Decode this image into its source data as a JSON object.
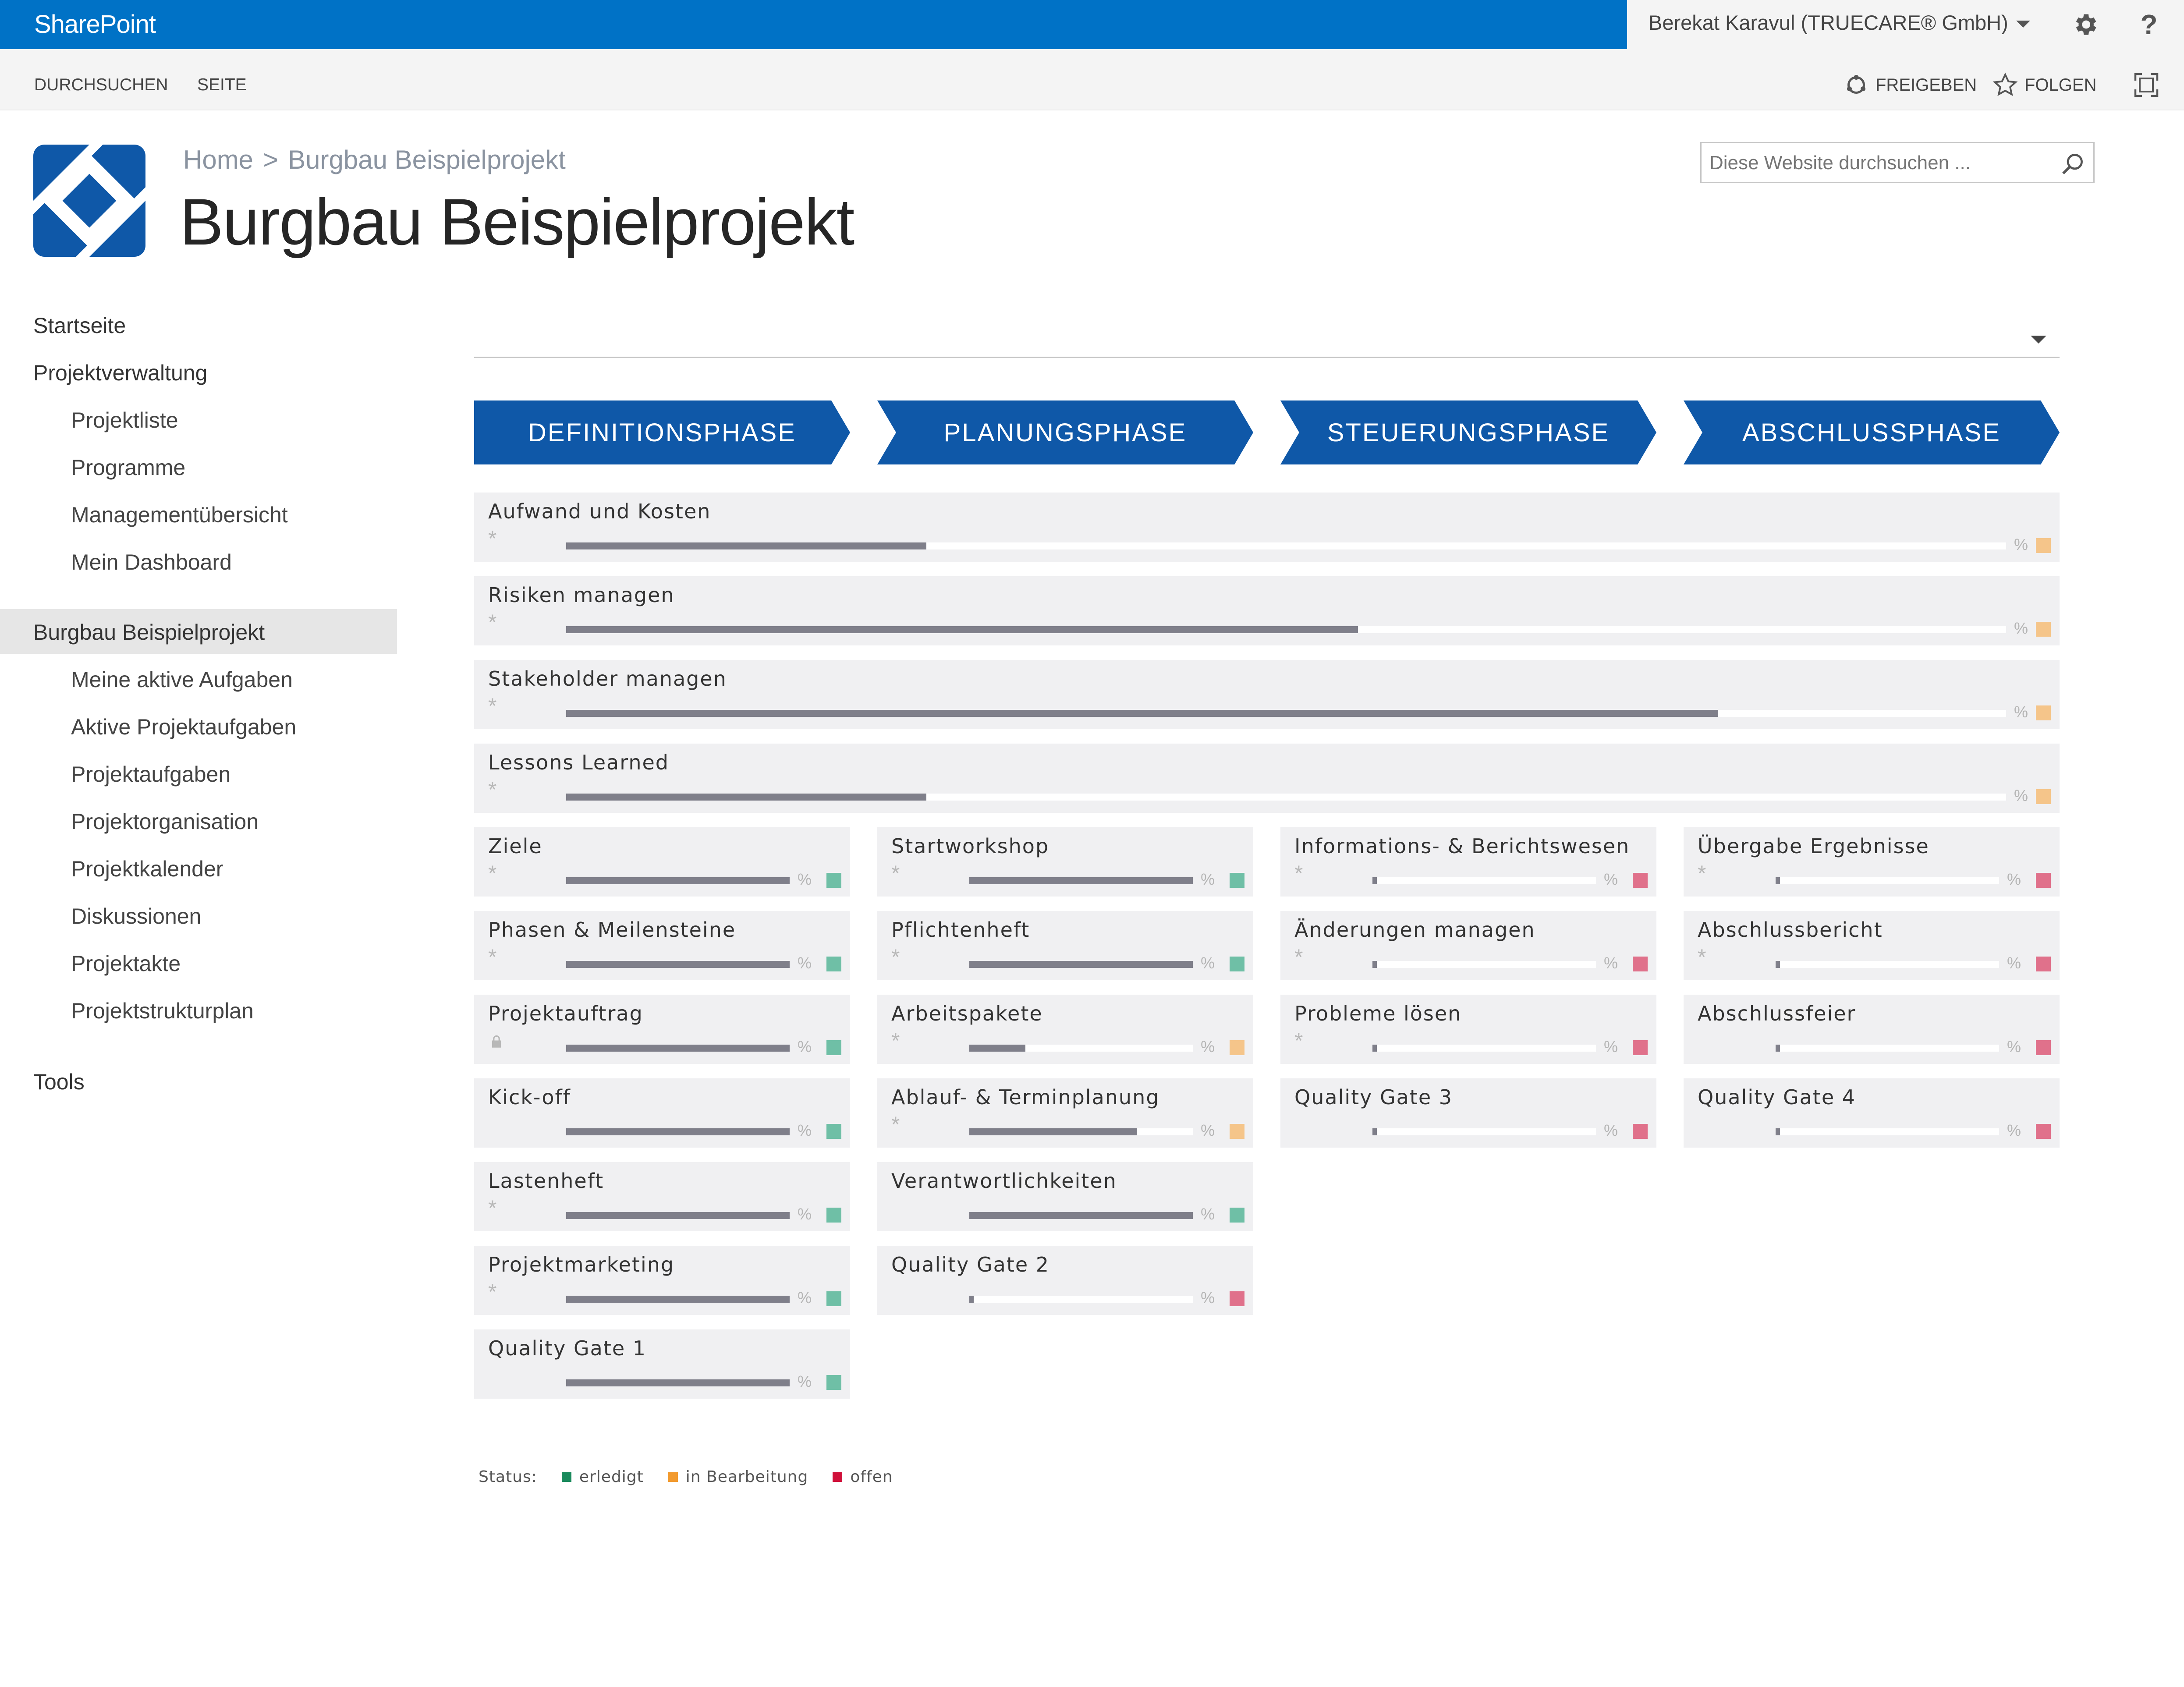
{
  "suite": {
    "brand": "SharePoint",
    "user": "Berekat Karavul (TRUECARE® GmbH)",
    "icons": [
      "gear-icon",
      "help-icon"
    ],
    "help_glyph": "?"
  },
  "ribbon": {
    "tabs": [
      "DURCHSUCHEN",
      "SEITE"
    ],
    "share_label": "FREIGEBEN",
    "follow_label": "FOLGEN",
    "focus_icon": "focus-mode-icon"
  },
  "header": {
    "breadcrumb_home": "Home",
    "breadcrumb_sep": ">",
    "breadcrumb_current": "Burgbau Beispielprojekt",
    "title": "Burgbau Beispielprojekt",
    "search_placeholder": "Diese Website durchsuchen ..."
  },
  "nav": {
    "items": [
      {
        "label": "Startseite",
        "level": 0
      },
      {
        "label": "Projektverwaltung",
        "level": 0
      },
      {
        "label": "Projektliste",
        "level": 1
      },
      {
        "label": "Programme",
        "level": 1
      },
      {
        "label": "Managementübersicht",
        "level": 1
      },
      {
        "label": "Mein Dashboard",
        "level": 1
      },
      {
        "label": "Burgbau Beispielprojekt",
        "level": 0,
        "selected": true
      },
      {
        "label": "Meine aktive Aufgaben",
        "level": 1
      },
      {
        "label": "Aktive Projektaufgaben",
        "level": 1
      },
      {
        "label": "Projektaufgaben",
        "level": 1
      },
      {
        "label": "Projektorganisation",
        "level": 1
      },
      {
        "label": "Projektkalender",
        "level": 1
      },
      {
        "label": "Diskussionen",
        "level": 1
      },
      {
        "label": "Projektakte",
        "level": 1
      },
      {
        "label": "Projektstrukturplan",
        "level": 1
      },
      {
        "label": "Tools",
        "level": 0
      }
    ]
  },
  "colors": {
    "brand": "#0072c6",
    "phase": "#0f58a8",
    "done": "#6fbfa6",
    "in_progress": "#f5c58a",
    "open": "#e0718b",
    "legend_done": "#1a8a5c",
    "legend_in_progress": "#f29a2e",
    "legend_open": "#d0103a"
  },
  "phases": [
    "DEFINITIONSPHASE",
    "PLANUNGSPHASE",
    "STEUERUNGSPHASE",
    "ABSCHLUSSPHASE"
  ],
  "wide_tasks": [
    {
      "title": "Aufwand und Kosten",
      "progress": 0.25,
      "status": "in_progress",
      "mark": "*"
    },
    {
      "title": "Risiken managen",
      "progress": 0.55,
      "status": "in_progress",
      "mark": "*"
    },
    {
      "title": "Stakeholder managen",
      "progress": 0.8,
      "status": "in_progress",
      "mark": "*"
    },
    {
      "title": "Lessons Learned",
      "progress": 0.25,
      "status": "in_progress",
      "mark": "*"
    }
  ],
  "columns": [
    [
      {
        "title": "Ziele",
        "progress": 1.0,
        "status": "done",
        "mark": "*"
      },
      {
        "title": "Phasen & Meilensteine",
        "progress": 1.0,
        "status": "done",
        "mark": "*"
      },
      {
        "title": "Projektauftrag",
        "progress": 1.0,
        "status": "done",
        "mark": "lock"
      },
      {
        "title": "Kick-off",
        "progress": 1.0,
        "status": "done",
        "mark": ""
      },
      {
        "title": "Lastenheft",
        "progress": 1.0,
        "status": "done",
        "mark": "*"
      },
      {
        "title": "Projektmarketing",
        "progress": 1.0,
        "status": "done",
        "mark": "*"
      },
      {
        "title": "Quality Gate 1",
        "progress": 1.0,
        "status": "done",
        "mark": ""
      }
    ],
    [
      {
        "title": "Startworkshop",
        "progress": 1.0,
        "status": "done",
        "mark": "*"
      },
      {
        "title": "Pflichtenheft",
        "progress": 1.0,
        "status": "done",
        "mark": "*"
      },
      {
        "title": "Arbeitspakete",
        "progress": 0.25,
        "status": "in_progress",
        "mark": "*"
      },
      {
        "title": "Ablauf- & Terminplanung",
        "progress": 0.75,
        "status": "in_progress",
        "mark": "*"
      },
      {
        "title": "Verantwortlichkeiten",
        "progress": 1.0,
        "status": "done",
        "mark": ""
      },
      {
        "title": "Quality Gate 2",
        "progress": 0.02,
        "status": "open",
        "mark": ""
      }
    ],
    [
      {
        "title": "Informations- & Berichtswesen",
        "progress": 0.02,
        "status": "open",
        "mark": "*"
      },
      {
        "title": "Änderungen managen",
        "progress": 0.02,
        "status": "open",
        "mark": "*"
      },
      {
        "title": "Probleme lösen",
        "progress": 0.02,
        "status": "open",
        "mark": "*"
      },
      {
        "title": "Quality Gate 3",
        "progress": 0.02,
        "status": "open",
        "mark": ""
      }
    ],
    [
      {
        "title": "Übergabe Ergebnisse",
        "progress": 0.02,
        "status": "open",
        "mark": "*"
      },
      {
        "title": "Abschlussbericht",
        "progress": 0.02,
        "status": "open",
        "mark": "*"
      },
      {
        "title": "Abschlussfeier",
        "progress": 0.02,
        "status": "open",
        "mark": ""
      },
      {
        "title": "Quality Gate 4",
        "progress": 0.02,
        "status": "open",
        "mark": ""
      }
    ]
  ],
  "percent_symbol": "%",
  "legend": {
    "label": "Status:",
    "items": [
      {
        "label": "erledigt",
        "status": "done"
      },
      {
        "label": "in Bearbeitung",
        "status": "in_progress"
      },
      {
        "label": "offen",
        "status": "open"
      }
    ]
  }
}
